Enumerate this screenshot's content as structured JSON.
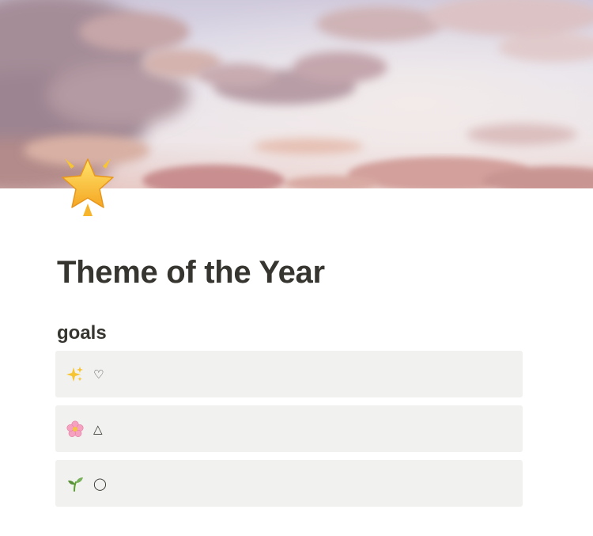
{
  "page": {
    "icon": "glowing-star-emoji",
    "cover": "pink-sunset-sky-clouds",
    "title": "Theme of the Year"
  },
  "section": {
    "heading": "goals"
  },
  "callouts": [
    {
      "icon": "sparkles-emoji",
      "text": "♡"
    },
    {
      "icon": "cherry-blossom-emoji",
      "text": "△"
    },
    {
      "icon": "seedling-emoji",
      "text": "◯"
    }
  ],
  "colors": {
    "text": "#37352f",
    "callout_bg": "#f1f1ef",
    "page_bg": "#ffffff"
  }
}
